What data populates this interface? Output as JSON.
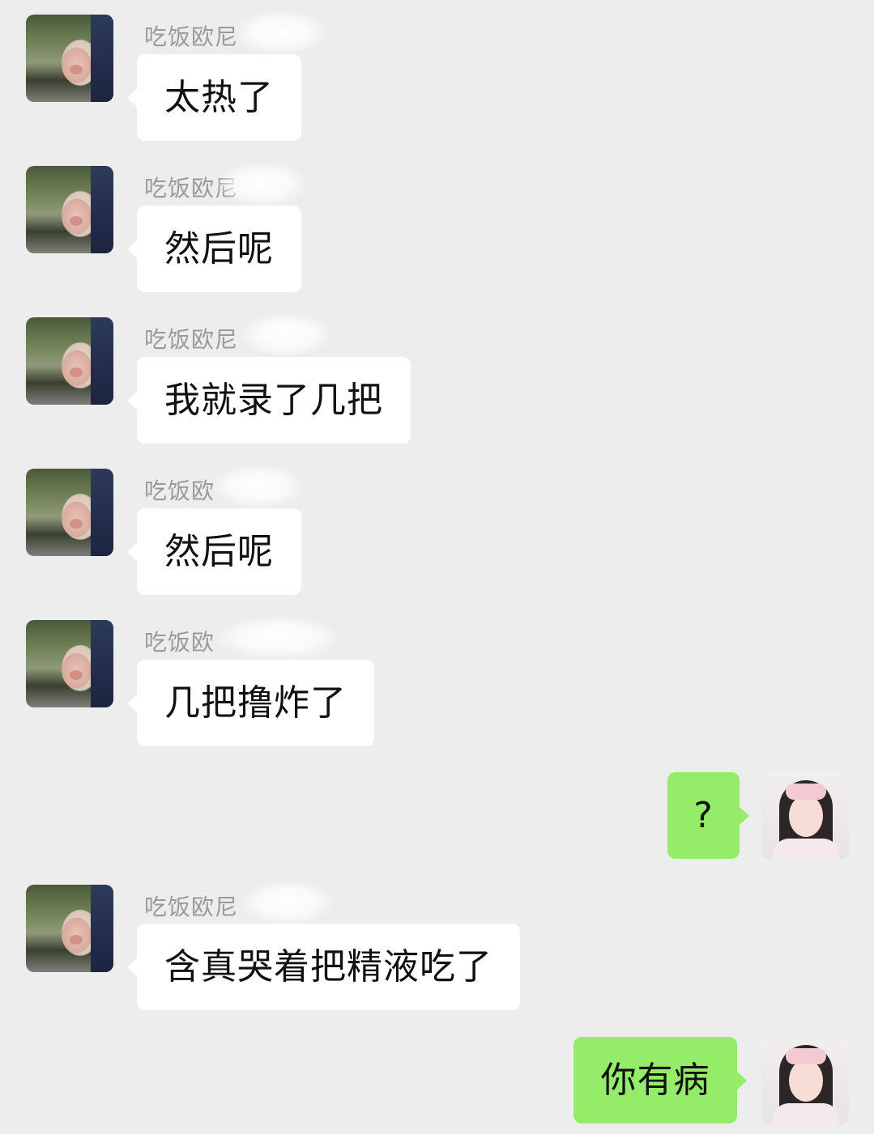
{
  "conversation": {
    "messages": [
      {
        "sender": "other",
        "nickname": "吃饭欧尼",
        "text": "太热了"
      },
      {
        "sender": "other",
        "nickname": "吃饭欧尼",
        "text": "然后呢"
      },
      {
        "sender": "other",
        "nickname": "吃饭欧尼",
        "text": "我就录了几把"
      },
      {
        "sender": "other",
        "nickname": "吃饭欧",
        "text": "然后呢"
      },
      {
        "sender": "other",
        "nickname": "吃饭欧",
        "text": "几把撸炸了"
      },
      {
        "sender": "me",
        "text": "?"
      },
      {
        "sender": "other",
        "nickname": "吃饭欧尼",
        "text": "含真哭着把精液吃了"
      },
      {
        "sender": "me",
        "text": "你有病"
      }
    ]
  },
  "colors": {
    "background": "#ededed",
    "incoming_bubble": "#ffffff",
    "outgoing_bubble": "#95ec69",
    "nickname": "#9a9a9a",
    "text": "#111111"
  },
  "icons": {
    "other_avatar": "pig-avatar-icon",
    "my_avatar": "girl-avatar-icon"
  }
}
